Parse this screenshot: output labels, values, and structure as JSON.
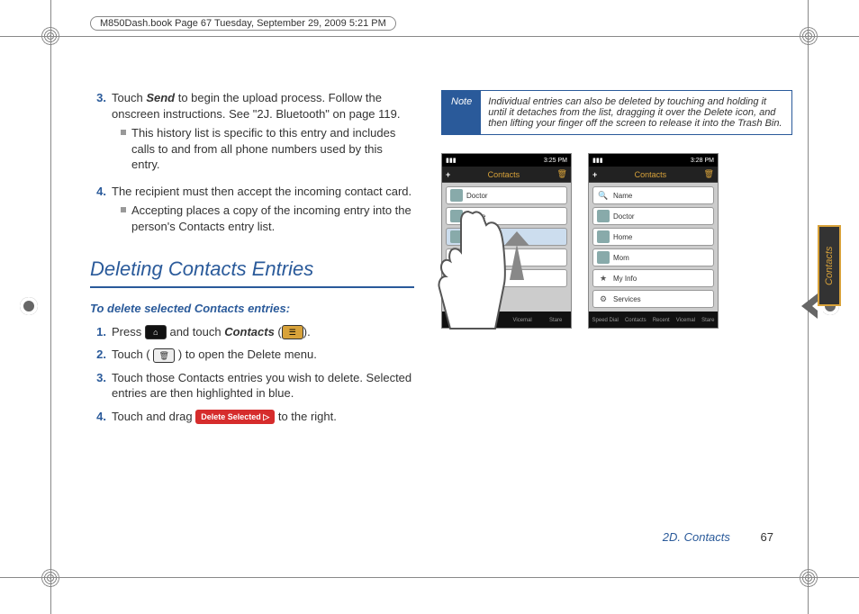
{
  "header": {
    "running_head": "M850Dash.book  Page 67  Tuesday, September 29, 2009  5:21 PM"
  },
  "left_col": {
    "prev_steps": {
      "step3": {
        "num": "3.",
        "text_a": "Touch ",
        "text_send": "Send",
        "text_b": " to begin the upload process. Follow the onscreen instructions. See \"2J. Bluetooth\" on page 119.",
        "bullet": "This history list is specific to this entry and includes calls to and from all phone numbers used by this entry."
      },
      "step4": {
        "num": "4.",
        "text": "The recipient must then accept the incoming contact card.",
        "bullet": "Accepting places a copy of the incoming entry into the person's Contacts entry list."
      }
    },
    "section_title": "Deleting Contacts Entries",
    "subhead": "To delete selected Contacts entries:",
    "steps": {
      "s1": {
        "num": "1.",
        "a": "Press ",
        "b": " and touch ",
        "contacts": "Contacts",
        "c": " (",
        "d": ")."
      },
      "s2": {
        "num": "2.",
        "a": "Touch (",
        "b": ") to open the Delete menu."
      },
      "s3": {
        "num": "3.",
        "text": "Touch those Contacts entries you wish to delete. Selected entries are then highlighted in blue."
      },
      "s4": {
        "num": "4.",
        "a": "Touch and drag ",
        "del": "Delete Selected",
        "b": " to the right."
      }
    }
  },
  "note": {
    "label": "Note",
    "text": "Individual entries can also be deleted by touching and holding it until it detaches from the list, dragging it over the Delete icon, and then lifting your finger off the screen to release it into the Trash Bin."
  },
  "phone1": {
    "time": "3:25 PM",
    "title": "Contacts",
    "rows": [
      "Doctor",
      "Home",
      "Mom",
      "fo",
      "ervices"
    ],
    "tabs": [
      "atch",
      "Recent",
      "Vicemal",
      "Stare"
    ]
  },
  "phone2": {
    "time": "3:28 PM",
    "title": "Contacts",
    "rows": [
      "Name",
      "Doctor",
      "Home",
      "Mom",
      "My Info",
      "Services"
    ],
    "tabs": [
      "Speed Dial",
      "Contacts",
      "Recent",
      "Vicemal",
      "Stare"
    ]
  },
  "side_tab": "Contacts",
  "footer": {
    "section": "2D. Contacts",
    "page": "67"
  },
  "icons": {
    "home": "⌂",
    "contacts": "☰",
    "trash": "🗑",
    "search": "🔍",
    "star": "★",
    "gear": "⚙"
  }
}
